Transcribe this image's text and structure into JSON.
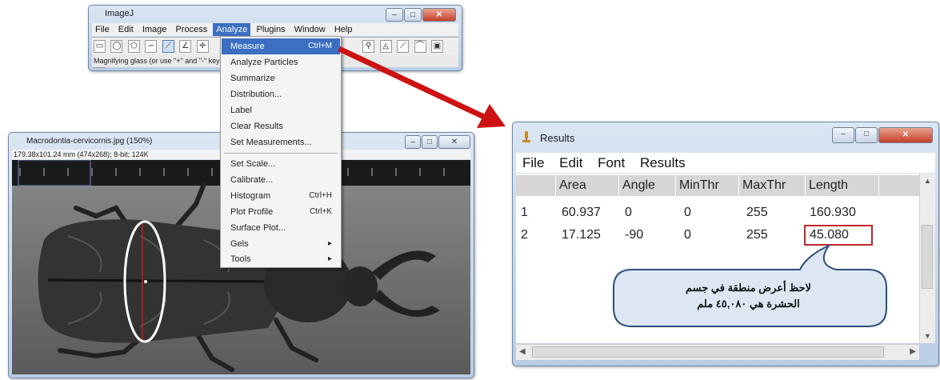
{
  "imagej": {
    "title": "ImageJ",
    "menus": [
      "File",
      "Edit",
      "Image",
      "Process",
      "Analyze",
      "Plugins",
      "Window",
      "Help"
    ],
    "active_menu": "Analyze",
    "status": "Magnifying glass (or use \"+\" and \"-\" keys)"
  },
  "analyze_menu": {
    "items": [
      {
        "label": "Measure",
        "shortcut": "Ctrl+M"
      },
      {
        "label": "Analyze Particles",
        "shortcut": ""
      },
      {
        "label": "Summarize",
        "shortcut": ""
      },
      {
        "label": "Distribution...",
        "shortcut": ""
      },
      {
        "label": "Label",
        "shortcut": ""
      },
      {
        "label": "Clear Results",
        "shortcut": ""
      },
      {
        "label": "Set Measurements...",
        "shortcut": ""
      },
      {
        "label": "Set Scale...",
        "shortcut": ""
      },
      {
        "label": "Calibrate...",
        "shortcut": ""
      },
      {
        "label": "Histogram",
        "shortcut": "Ctrl+H"
      },
      {
        "label": "Plot Profile",
        "shortcut": "Ctrl+K"
      },
      {
        "label": "Surface Plot...",
        "shortcut": ""
      },
      {
        "label": "Gels",
        "shortcut": ""
      },
      {
        "label": "Tools",
        "shortcut": ""
      }
    ]
  },
  "image_window": {
    "title": "Macrodontia-cervicornis.jpg (150%)",
    "info": "179.38x101.24 mm (474x268); 8-bit; 124K"
  },
  "results": {
    "title": "Results",
    "menus": [
      "File",
      "Edit",
      "Font",
      "Results"
    ],
    "columns": [
      "Area",
      "Angle",
      "MinThr",
      "MaxThr",
      "Length"
    ],
    "rows": [
      {
        "n": "1",
        "area": "60.937",
        "angle": "0",
        "minthr": "0",
        "maxthr": "255",
        "length": "160.930"
      },
      {
        "n": "2",
        "area": "17.125",
        "angle": "-90",
        "minthr": "0",
        "maxthr": "255",
        "length": "45.080"
      }
    ]
  },
  "callout": {
    "line1": "لاحظ أعرض منطقة في جسم",
    "line2": "الحشرة هي ٤٥,٠٨٠ ملم"
  },
  "colors": {
    "arrow": "#cc1212",
    "highlight": "#3b6fc1",
    "ellipse": "#ffffff"
  }
}
